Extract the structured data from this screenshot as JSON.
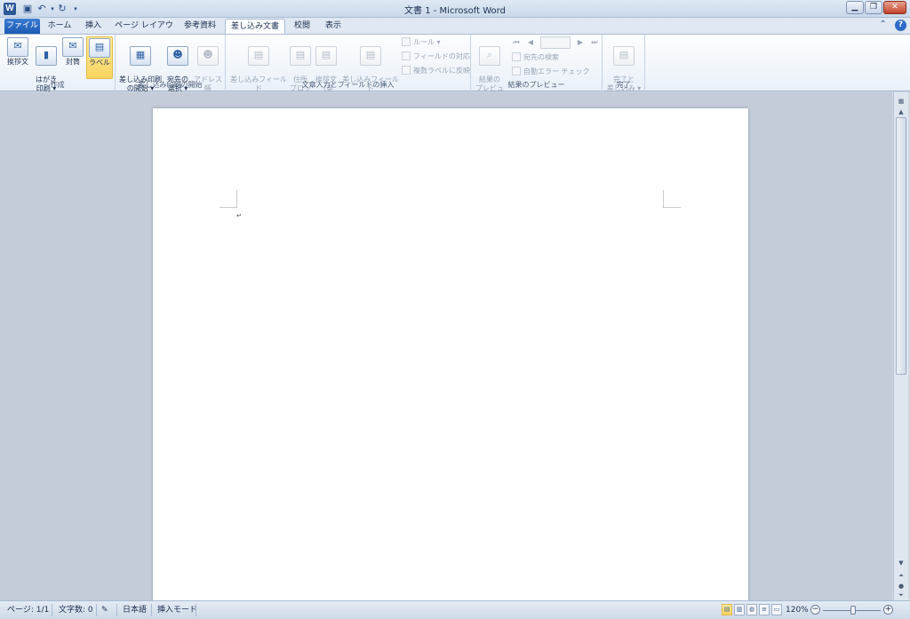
{
  "window": {
    "title": "文書 1 - Microsoft Word",
    "app_icon_letter": "W",
    "buttons": {
      "minimize": "▁",
      "maximize": "❐",
      "close": "✕"
    }
  },
  "tabs": [
    "ファイル",
    "ホーム",
    "挿入",
    "ページ レイアウト",
    "参考資料",
    "差し込み文書",
    "校閲",
    "表示"
  ],
  "active_tab": "差し込み文書",
  "ribbon": {
    "groups": {
      "create": {
        "label": "作成",
        "buttons": [
          "挨拶文",
          "はがき\n印刷 ▾",
          "封筒",
          "ラベル"
        ]
      },
      "start_merge": {
        "label": "差し込み印刷の開始",
        "buttons": [
          "差し込み印刷\nの開始 ▾",
          "宛先の\n選択 ▾",
          "アドレス帳\nの編集"
        ]
      },
      "write_insert": {
        "label": "文章入力とフィールドの挿入",
        "buttons": [
          "差し込みフィールド\nの強調表示",
          "住所\nブロック",
          "挨拶文\n（英文）",
          "差し込みフィールド\nの挿入 ▾"
        ],
        "small": [
          "ルール ▾",
          "フィールドの対応",
          "複数ラベルに反映"
        ]
      },
      "preview": {
        "label": "結果のプレビュー",
        "button": "結果の\nプレビュー",
        "small": [
          "宛先の検索",
          "自動エラー チェック"
        ]
      },
      "finish": {
        "label": "完了",
        "button": "完了と\n差し込み ▾"
      }
    },
    "selected_button": "ラベル"
  },
  "document": {
    "paragraph_mark": "↵"
  },
  "statusbar": {
    "page": "ページ: 1/1",
    "words": "文字数: 0",
    "language": "日本語",
    "mode": "挿入モード",
    "zoom": "120%"
  }
}
